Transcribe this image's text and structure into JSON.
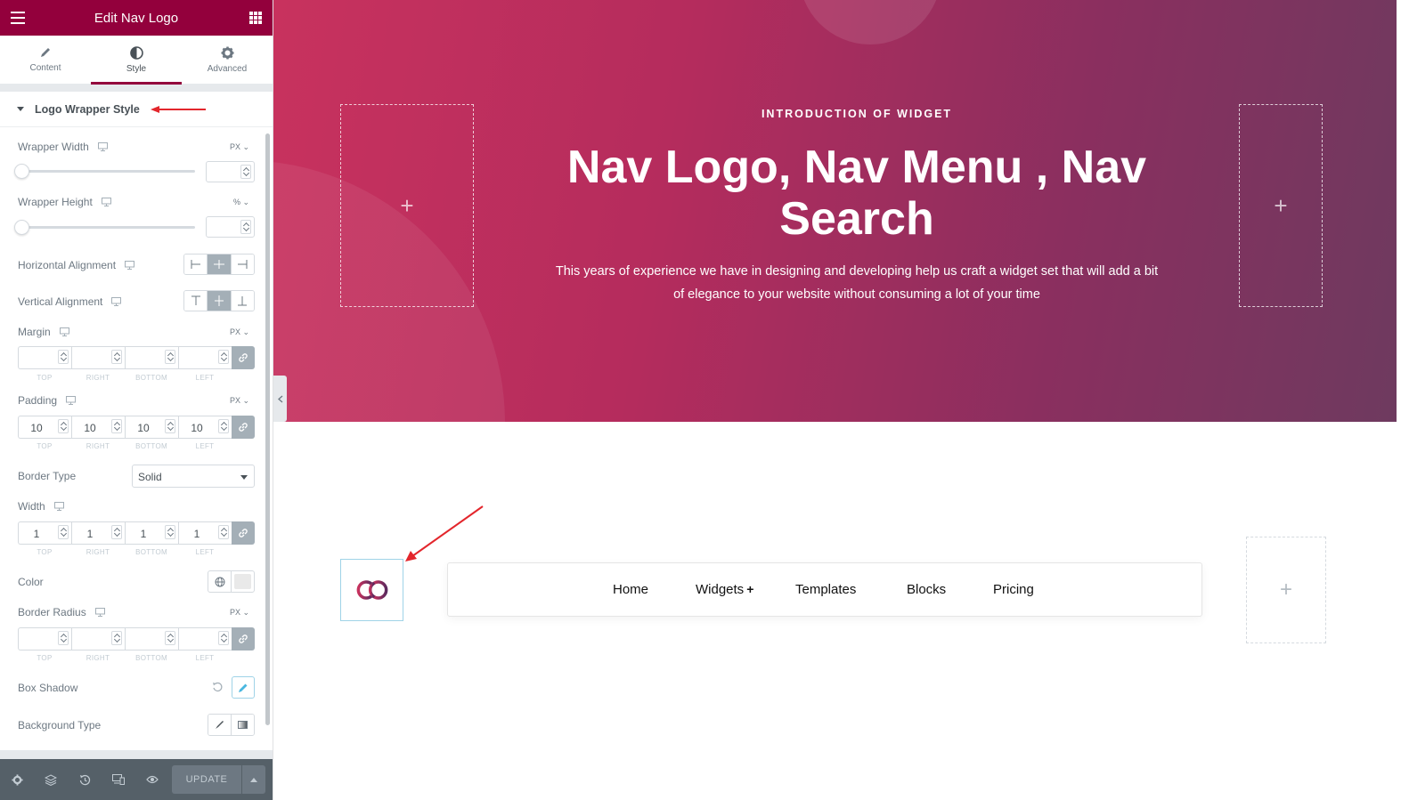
{
  "panel": {
    "title": "Edit Nav Logo",
    "tabs": [
      {
        "label": "Content",
        "icon": "pencil-icon",
        "active": false
      },
      {
        "label": "Style",
        "icon": "half-circle-icon",
        "active": true
      },
      {
        "label": "Advanced",
        "icon": "gear-icon",
        "active": false
      }
    ],
    "section_title": "Logo Wrapper Style",
    "wrapper_width": {
      "label": "Wrapper Width",
      "unit": "PX",
      "value": ""
    },
    "wrapper_height": {
      "label": "Wrapper Height",
      "unit": "%",
      "value": ""
    },
    "horizontal_alignment": {
      "label": "Horizontal Alignment",
      "selected": "center"
    },
    "vertical_alignment": {
      "label": "Vertical Alignment",
      "selected": "middle"
    },
    "margin": {
      "label": "Margin",
      "unit": "PX",
      "top": "",
      "right": "",
      "bottom": "",
      "left": ""
    },
    "padding": {
      "label": "Padding",
      "unit": "PX",
      "top": "10",
      "right": "10",
      "bottom": "10",
      "left": "10"
    },
    "dim_labels": {
      "top": "TOP",
      "right": "RIGHT",
      "bottom": "BOTTOM",
      "left": "LEFT"
    },
    "border_type": {
      "label": "Border Type",
      "value": "Solid"
    },
    "border_width": {
      "label": "Width",
      "top": "1",
      "right": "1",
      "bottom": "1",
      "left": "1"
    },
    "color": {
      "label": "Color",
      "swatch": "#e9e9e9"
    },
    "border_radius": {
      "label": "Border Radius",
      "unit": "PX",
      "top": "",
      "right": "",
      "bottom": "",
      "left": ""
    },
    "box_shadow": {
      "label": "Box Shadow"
    },
    "background_type": {
      "label": "Background Type"
    },
    "footer": {
      "update_label": "UPDATE"
    }
  },
  "hero": {
    "kicker": "INTRODUCTION OF WIDGET",
    "headline": "Nav Logo, Nav Menu , Nav Search",
    "description": "This years of experience we have in designing and developing help us craft a widget set that will add a bit of elegance to your website without consuming a lot of your time",
    "add_symbol": "+"
  },
  "nav": {
    "items": [
      {
        "label": "Home"
      },
      {
        "label": "Widgets",
        "has_submenu": true,
        "submenu_symbol": "+"
      },
      {
        "label": "Templates"
      },
      {
        "label": "Blocks"
      },
      {
        "label": "Pricing"
      }
    ]
  },
  "colors": {
    "brand": "#93003c",
    "panel_footer": "#556068",
    "hero_start": "#c8325e",
    "hero_end": "#6e3a5f",
    "annotation_arrow": "#e3262c"
  }
}
